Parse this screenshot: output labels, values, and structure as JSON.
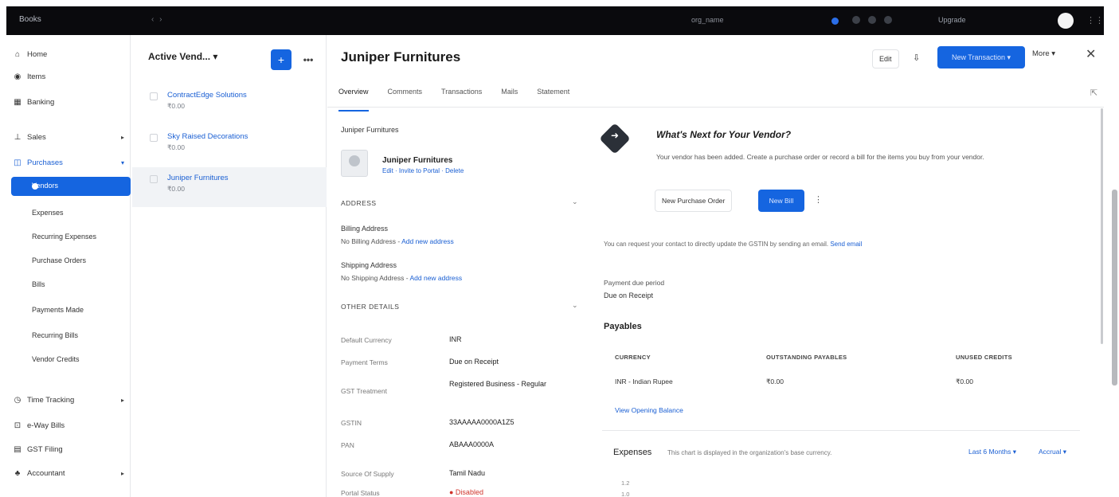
{
  "topbar": {
    "brand": "Books",
    "nav": "‹ ›",
    "org": "org_name",
    "plan": "Upgrade",
    "grid_icon": "grid-icon"
  },
  "sidebar": {
    "items": [
      {
        "label": "Home",
        "icon": "home-icon",
        "glyph": "⌂"
      },
      {
        "label": "Items",
        "icon": "tag-icon",
        "glyph": "◉"
      },
      {
        "label": "Banking",
        "icon": "bank-icon",
        "glyph": "▦"
      },
      {
        "label": "Sales",
        "icon": "cart-icon",
        "glyph": "⊥"
      },
      {
        "label": "Purchases",
        "icon": "bag-icon",
        "glyph": "◫"
      },
      {
        "label": "Time Tracking",
        "icon": "clock-icon",
        "glyph": "◷"
      },
      {
        "label": "e-Way Bills",
        "icon": "truck-icon",
        "glyph": "⊡"
      },
      {
        "label": "GST Filing",
        "icon": "file-icon",
        "glyph": "▤"
      },
      {
        "label": "Accountant",
        "icon": "person-icon",
        "glyph": "♣"
      }
    ],
    "active": "Vendors",
    "sub_items": [
      "Expenses",
      "Recurring Expenses",
      "Purchase Orders",
      "Bills",
      "Payments Made",
      "Recurring Bills",
      "Vendor Credits"
    ]
  },
  "list": {
    "filter": "Active Vend... ▾",
    "add": "+",
    "more": "•••",
    "vendors": [
      {
        "name": "ContractEdge Solutions",
        "amount": "₹0.00"
      },
      {
        "name": "Sky Raised Decorations",
        "amount": "₹0.00"
      },
      {
        "name": "Juniper Furnitures",
        "amount": "₹0.00"
      }
    ]
  },
  "header": {
    "title": "Juniper Furnitures",
    "edit": "Edit",
    "attach": "⇩",
    "new_transaction": "New Transaction ▾",
    "more": "More ▾",
    "close": "✕"
  },
  "tabs": [
    "Overview",
    "Comments",
    "Transactions",
    "Mails",
    "Statement"
  ],
  "overview": {
    "company": "Juniper Furnitures",
    "contact_name": "Juniper Furnitures",
    "contact_links": "Edit · Invite to Portal · Delete",
    "address_header": "ADDRESS",
    "billing_label": "Billing Address",
    "billing_none": "No Billing Address - ",
    "billing_link": "Add new address",
    "shipping_label": "Shipping Address",
    "shipping_none": "No Shipping Address - ",
    "shipping_link": "Add new address",
    "other_header": "OTHER DETAILS",
    "details": [
      {
        "k": "Default Currency",
        "v": "INR"
      },
      {
        "k": "Payment Terms",
        "v": "Due on Receipt"
      },
      {
        "k": "GST Treatment",
        "v": "Registered Business - Regular"
      },
      {
        "k": "GSTIN",
        "v": "33AAAAA0000A1Z5"
      },
      {
        "k": "PAN",
        "v": "ABAAA0000A"
      },
      {
        "k": "Source Of Supply",
        "v": "Tamil Nadu"
      },
      {
        "k": "Portal Status",
        "v": "● Disabled"
      }
    ]
  },
  "whats_next": {
    "title": "What's Next for Your Vendor?",
    "desc": "Your vendor has been added. Create a purchase order or record a bill for the items you buy from your vendor.",
    "po_btn": "New Purchase Order",
    "bill_btn": "New Bill",
    "kebab": "⋮"
  },
  "gstin_note": {
    "text": "You can request your contact to directly update the GSTIN by sending an email. ",
    "link": "Send email"
  },
  "payment": {
    "label": "Payment due period",
    "value": "Due on Receipt"
  },
  "payables": {
    "title": "Payables",
    "headers": [
      "CURRENCY",
      "OUTSTANDING PAYABLES",
      "UNUSED CREDITS"
    ],
    "row": [
      "INR - Indian Rupee",
      "₹0.00",
      "₹0.00"
    ],
    "view_balance": "View Opening Balance"
  },
  "expenses": {
    "title": "Expenses",
    "note": "This chart is displayed in the organization's base currency.",
    "period": "Last 6 Months ▾",
    "basis": "Accrual ▾",
    "ticks": [
      "1.2",
      "1.0"
    ]
  }
}
